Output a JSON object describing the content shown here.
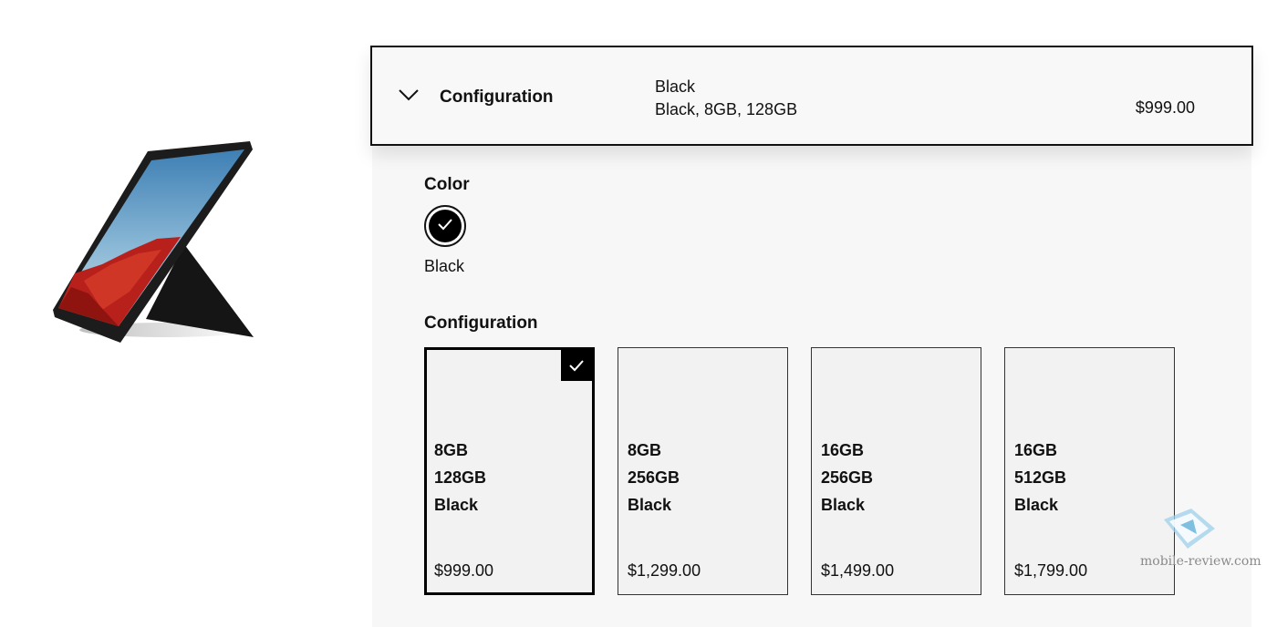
{
  "configuration_header": {
    "title": "Configuration",
    "selected_color": "Black",
    "selected_summary": "Black, 8GB, 128GB",
    "price": "$999.00"
  },
  "color_section": {
    "label": "Color",
    "options": [
      {
        "name": "Black",
        "swatch": "#000000",
        "selected": true
      }
    ]
  },
  "configuration_section": {
    "label": "Configuration",
    "options": [
      {
        "ram": "8GB",
        "storage": "128GB",
        "color": "Black",
        "price": "$999.00",
        "selected": true
      },
      {
        "ram": "8GB",
        "storage": "256GB",
        "color": "Black",
        "price": "$1,299.00",
        "selected": false
      },
      {
        "ram": "16GB",
        "storage": "256GB",
        "color": "Black",
        "price": "$1,499.00",
        "selected": false
      },
      {
        "ram": "16GB",
        "storage": "512GB",
        "color": "Black",
        "price": "$1,799.00",
        "selected": false
      }
    ]
  },
  "watermark": {
    "text": "mobile-review.com"
  },
  "icons": {
    "header": "chevron-down-icon",
    "selected_color": "checkmark-icon",
    "selected_card": "checkmark-icon",
    "product": "tablet-image",
    "watermark": "mobile-review-logo"
  }
}
